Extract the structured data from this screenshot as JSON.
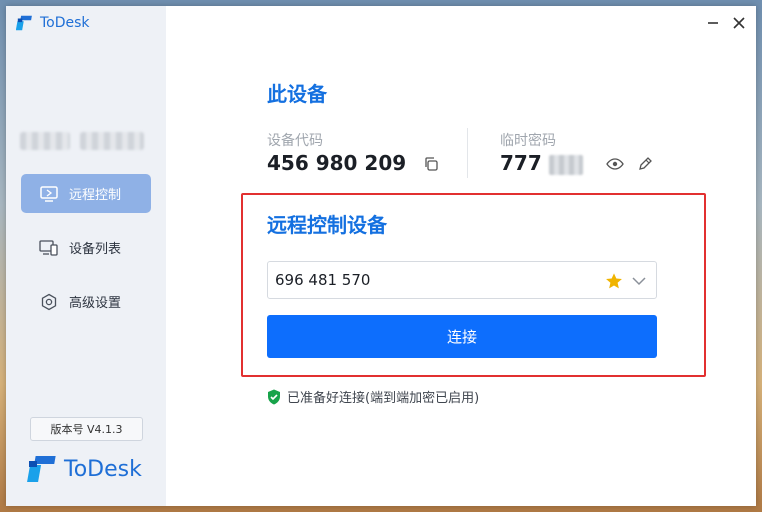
{
  "app": {
    "name": "ToDesk"
  },
  "sidebar": {
    "items": [
      {
        "label": "远程控制",
        "icon": "remote-control-icon",
        "active": true
      },
      {
        "label": "设备列表",
        "icon": "device-list-icon",
        "active": false
      },
      {
        "label": "高级设置",
        "icon": "settings-icon",
        "active": false
      }
    ],
    "version": "版本号 V4.1.3",
    "brand": "ToDesk"
  },
  "this_device": {
    "title": "此设备",
    "code_label": "设备代码",
    "code_value": "456 980 209",
    "temp_pwd_label": "临时密码",
    "temp_pwd_visible": "777"
  },
  "remote": {
    "title": "远程控制设备",
    "device_id": "696 481 570",
    "connect_label": "连接"
  },
  "status": {
    "text": "已准备好连接(端到端加密已启用)"
  },
  "colors": {
    "accent": "#0d6efd",
    "highlight_border": "#e23030",
    "star": "#f0b400",
    "ok": "#17a34a"
  }
}
